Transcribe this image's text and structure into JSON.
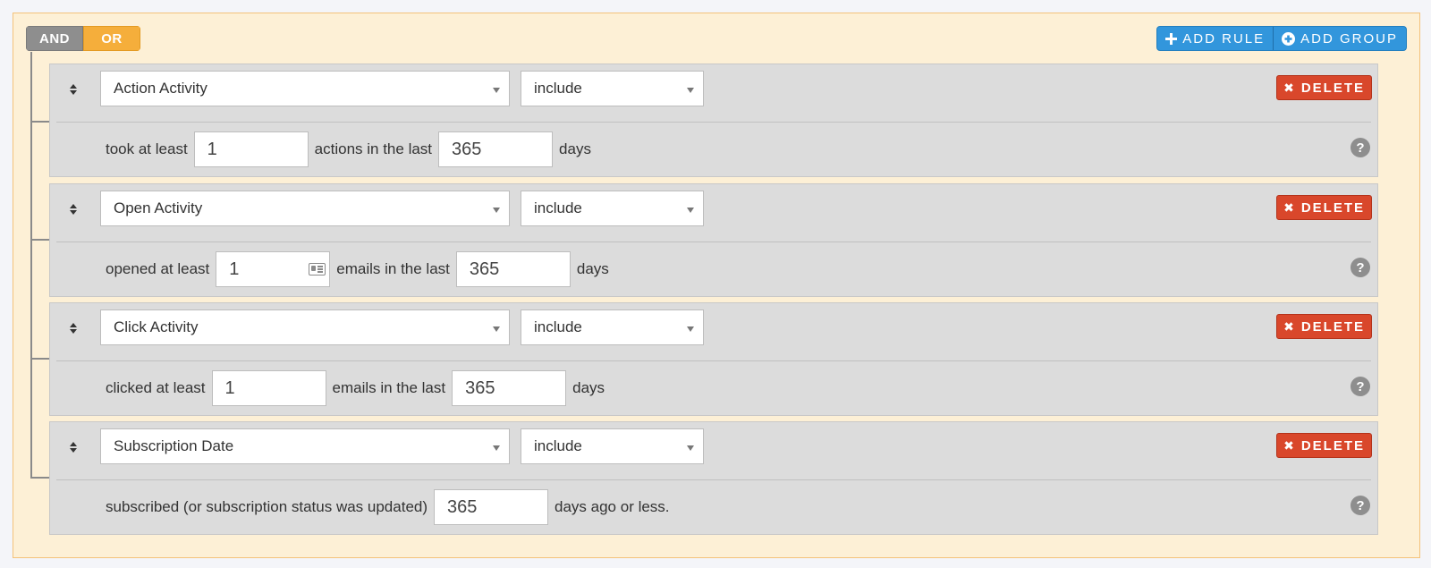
{
  "conditions": {
    "and_label": "AND",
    "or_label": "OR",
    "selected": "AND"
  },
  "actions": {
    "add_rule_label": "ADD RULE",
    "add_group_label": "ADD GROUP"
  },
  "rules": [
    {
      "field": "Action Activity",
      "operator": "include",
      "delete_label": "DELETE",
      "text1": "took at least",
      "value1": "1",
      "text2": "actions in the last",
      "value2": "365",
      "text3": "days"
    },
    {
      "field": "Open Activity",
      "operator": "include",
      "delete_label": "DELETE",
      "text1": "opened at least",
      "value1": "1",
      "text2": "emails in the last",
      "value2": "365",
      "text3": "days"
    },
    {
      "field": "Click Activity",
      "operator": "include",
      "delete_label": "DELETE",
      "text1": "clicked at least",
      "value1": "1",
      "text2": "emails in the last",
      "value2": "365",
      "text3": "days"
    },
    {
      "field": "Subscription Date",
      "operator": "include",
      "delete_label": "DELETE",
      "text1": "subscribed (or subscription status was updated)",
      "value1": "365",
      "text2": "days ago or less."
    }
  ],
  "help_glyph": "?",
  "colors": {
    "group_bg": "#fdf0d6",
    "and_bg": "#8e8e8e",
    "or_bg": "#f5ae3b",
    "add_bg": "#3296dc",
    "delete_bg": "#d9472b",
    "rule_bg": "#dcdcdc"
  }
}
